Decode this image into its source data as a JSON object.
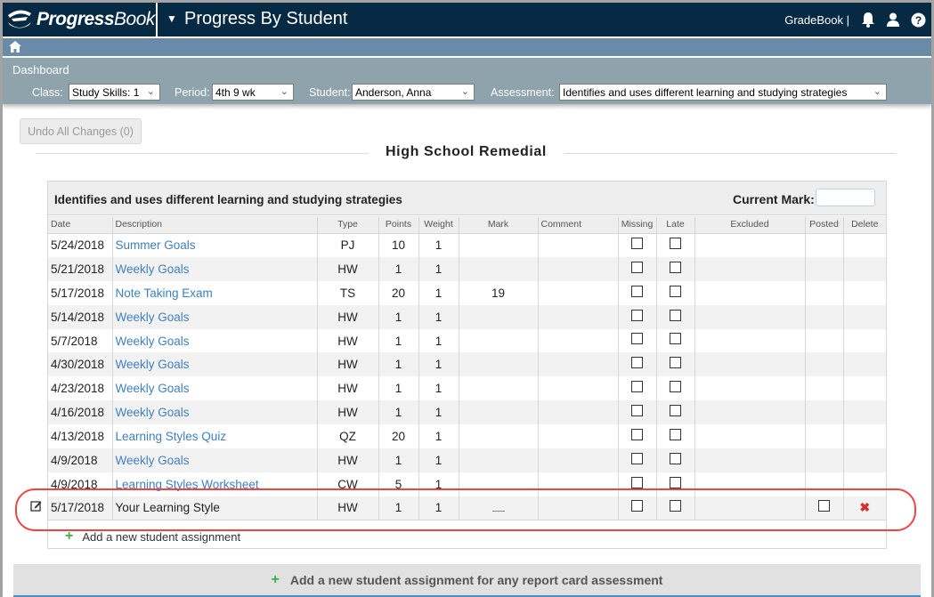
{
  "app": {
    "logo_text_bold": "Progress",
    "logo_text_light": "Book",
    "title": "Progress By Student",
    "gradebook_link": "GradeBook |"
  },
  "icons": {
    "notifications": "bell-icon",
    "user": "user-icon",
    "help": "help-icon",
    "home": "home-icon",
    "edit": "edit-icon",
    "add": "plus-icon",
    "delete": "x-icon"
  },
  "breadcrumb": {
    "dashboard": "Dashboard"
  },
  "filters": {
    "class_label": "Class:",
    "class_value": "Study Skills: 1",
    "period_label": "Period:",
    "period_value": "4th 9 wk",
    "student_label": "Student:",
    "student_value": "Anderson, Anna",
    "assessment_label": "Assessment:",
    "assessment_value": "Identifies and uses different learning and studying strategies"
  },
  "toolbar": {
    "undo_label": "Undo All Changes (0)"
  },
  "section": {
    "title": "High School Remedial"
  },
  "panel": {
    "title": "Identifies and uses different learning and studying strategies",
    "current_mark_label": "Current Mark:",
    "current_mark_value": ""
  },
  "table": {
    "headers": [
      "Date",
      "Description",
      "Type",
      "Points",
      "Weight",
      "Mark",
      "Comment",
      "Missing",
      "Late",
      "Excluded",
      "Posted",
      "Delete"
    ],
    "rows": [
      {
        "date": "5/24/2018",
        "description": "Summer Goals",
        "type": "PJ",
        "points": "10",
        "weight": "1",
        "mark": "",
        "comment": "",
        "missing": false,
        "late": false
      },
      {
        "date": "5/21/2018",
        "description": "Weekly Goals",
        "type": "HW",
        "points": "1",
        "weight": "1",
        "mark": "",
        "comment": "",
        "missing": false,
        "late": false
      },
      {
        "date": "5/17/2018",
        "description": "Note Taking Exam",
        "type": "TS",
        "points": "20",
        "weight": "1",
        "mark": "19",
        "comment": "",
        "missing": false,
        "late": false
      },
      {
        "date": "5/14/2018",
        "description": "Weekly Goals",
        "type": "HW",
        "points": "1",
        "weight": "1",
        "mark": "",
        "comment": "",
        "missing": false,
        "late": false
      },
      {
        "date": "5/7/2018",
        "description": "Weekly Goals",
        "type": "HW",
        "points": "1",
        "weight": "1",
        "mark": "",
        "comment": "",
        "missing": false,
        "late": false
      },
      {
        "date": "4/30/2018",
        "description": "Weekly Goals",
        "type": "HW",
        "points": "1",
        "weight": "1",
        "mark": "",
        "comment": "",
        "missing": false,
        "late": false
      },
      {
        "date": "4/23/2018",
        "description": "Weekly Goals",
        "type": "HW",
        "points": "1",
        "weight": "1",
        "mark": "",
        "comment": "",
        "missing": false,
        "late": false
      },
      {
        "date": "4/16/2018",
        "description": "Weekly Goals",
        "type": "HW",
        "points": "1",
        "weight": "1",
        "mark": "",
        "comment": "",
        "missing": false,
        "late": false
      },
      {
        "date": "4/13/2018",
        "description": "Learning Styles Quiz",
        "type": "QZ",
        "points": "20",
        "weight": "1",
        "mark": "",
        "comment": "",
        "missing": false,
        "late": false
      },
      {
        "date": "4/9/2018",
        "description": "Weekly Goals",
        "type": "HW",
        "points": "1",
        "weight": "1",
        "mark": "",
        "comment": "",
        "missing": false,
        "late": false
      },
      {
        "date": "4/9/2018",
        "description": "Learning Styles Worksheet",
        "type": "CW",
        "points": "5",
        "weight": "1",
        "mark": "",
        "comment": "",
        "missing": false,
        "late": false
      }
    ],
    "new_row": {
      "date": "5/17/2018",
      "description": "Your Learning Style",
      "type": "HW",
      "points": "1",
      "weight": "1",
      "mark": "__",
      "comment": "",
      "missing": false,
      "late": false,
      "posted": false
    }
  },
  "actions": {
    "add_student_assignment": "Add a new student assignment",
    "add_any_assessment": "Add a new student assignment for any report card assessment"
  },
  "colors": {
    "topbar": "#062a43",
    "crumbbar": "#6a8ba8",
    "filterbar": "#8ea3ac",
    "link": "#3f7fbf",
    "add_green": "#3cb04a",
    "delete_red": "#d63030",
    "highlight": "#ef4444"
  }
}
